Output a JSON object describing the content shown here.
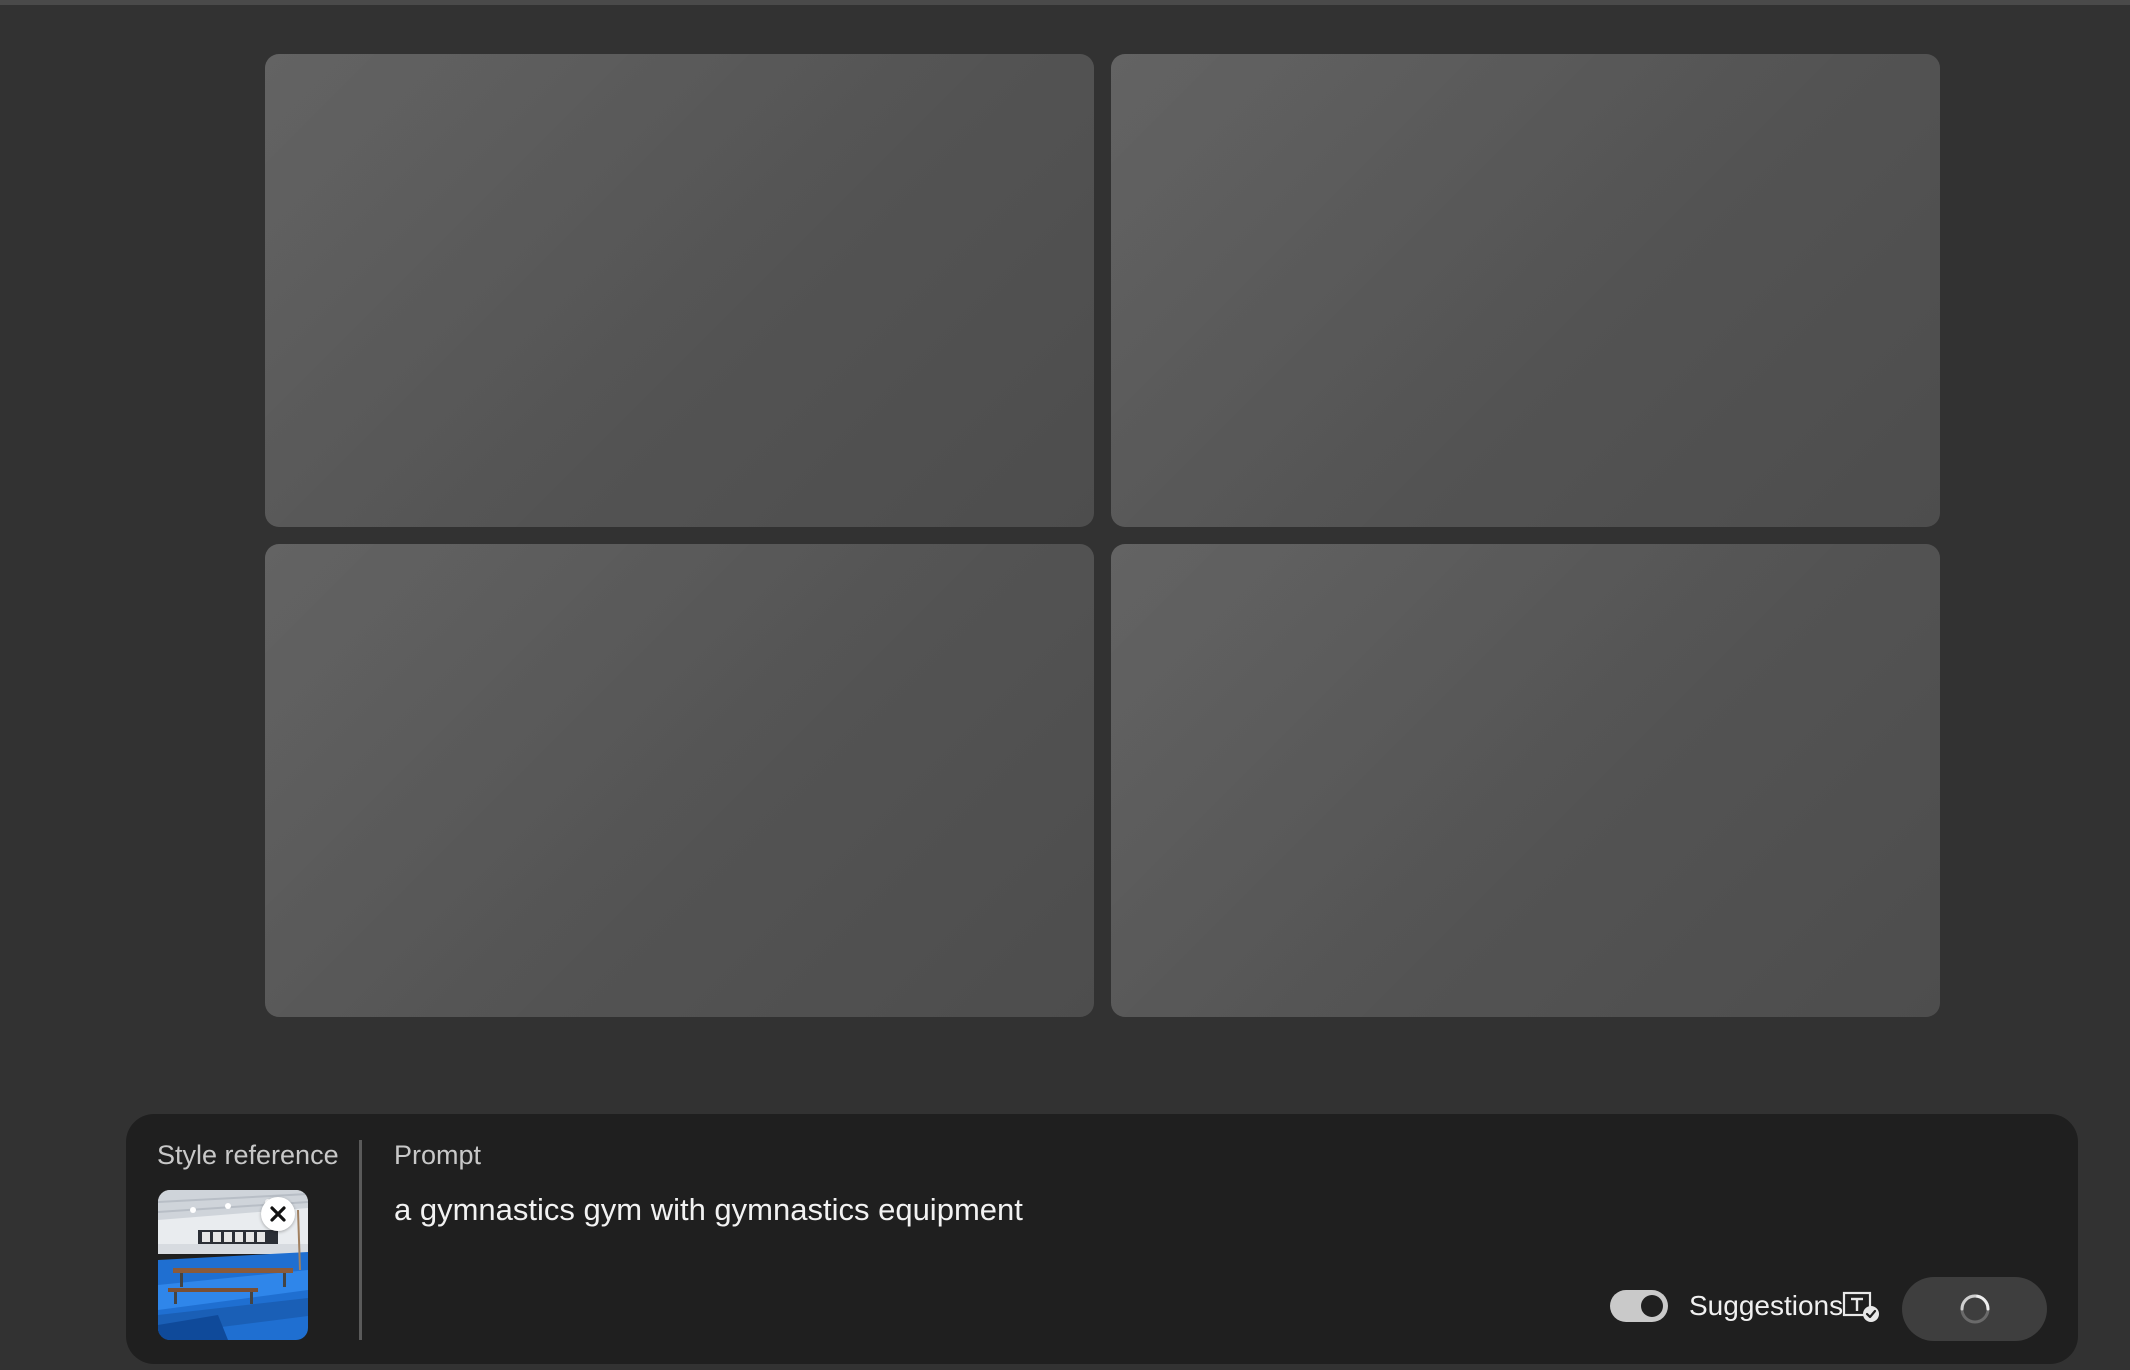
{
  "results": {
    "tiles": [
      "placeholder-1",
      "placeholder-2",
      "placeholder-3",
      "placeholder-4"
    ]
  },
  "panel": {
    "style_reference_label": "Style reference",
    "prompt_label": "Prompt",
    "prompt_text": "a gymnastics gym with gymnastics equipment",
    "suggestions_label": "Suggestions",
    "suggestions_enabled": true,
    "icons": {
      "remove": "close-icon",
      "suggestions": "text-check-icon",
      "generate": "loading-spinner-icon"
    }
  }
}
